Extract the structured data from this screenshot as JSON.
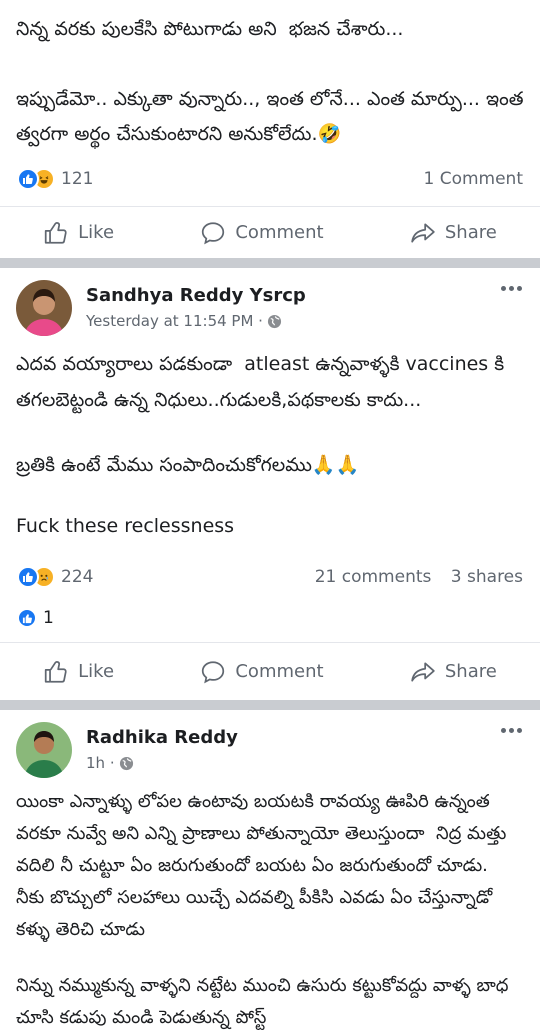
{
  "post1": {
    "paragraphs": [
      "నిన్న వరకు పులకేసి పోటుగాడు అని  భజన చేశారు...",
      "ఇప్పుడేమో.. ఎక్కుతా వున్నారు.., ఇంత లోనే... ఎంత మార్పు... ఇంత త్వరగా అర్థం చేసుకుంటారని అనుకోలేదు.🤣"
    ],
    "reaction_count": "121",
    "comments": "1 Comment"
  },
  "post2": {
    "author": "Sandhya Reddy Ysrcp",
    "time": "Yesterday at 11:54 PM ·",
    "paragraphs": [
      "ఎదవ వయ్యారాలు పడకుండా  atleast ఉన్నవాళ్ళకి vaccines కి తగలబెట్టండి ఉన్న నిధులు..గుడులకి,పథకాలకు కాదు...",
      "బ్రతికి ఉంటే మేము సంపాదించుకోగలము🙏🙏",
      "Fuck these reclessness"
    ],
    "reaction_count": "224",
    "comments": "21 comments",
    "shares": "3 shares",
    "second_reaction_count": "1"
  },
  "post3": {
    "author": "Radhika Reddy",
    "time": "1h ·",
    "paragraphs": [
      "యింకా ఎన్నాళ్ళు లోపల ఉంటావు బయటకి రావయ్య ఊపిరి ఉన్నంత వరకూ నువ్వే అని ఎన్ని ప్రాణాలు పోతున్నాయో తెలుస్తుందా  నిద్ర మత్తు వదిలి నీ చుట్టూ ఏం జరుగుతుందో బయట ఏం జరుగుతుందో చూడు.\nనీకు బొచ్చులో సలహాలు యిచ్చే ఎదవల్ని పీకిసి ఎవడు ఏం చేస్తున్నాడో కళ్ళు తెరిచి చూడు",
      "నిన్ను నమ్ముకున్న వాళ్ళని నట్టేట ముంచి ఉసురు కట్టుకోవద్దు వాళ్ళ బాధ చూసి కడుపు మండి పెడుతున్న పోస్ట్"
    ]
  },
  "actions": {
    "like": "Like",
    "comment": "Comment",
    "share": "Share"
  },
  "colors": {
    "like_blue": "#1877f2",
    "divider": "#c9ccd1",
    "meta_gray": "#606770"
  }
}
